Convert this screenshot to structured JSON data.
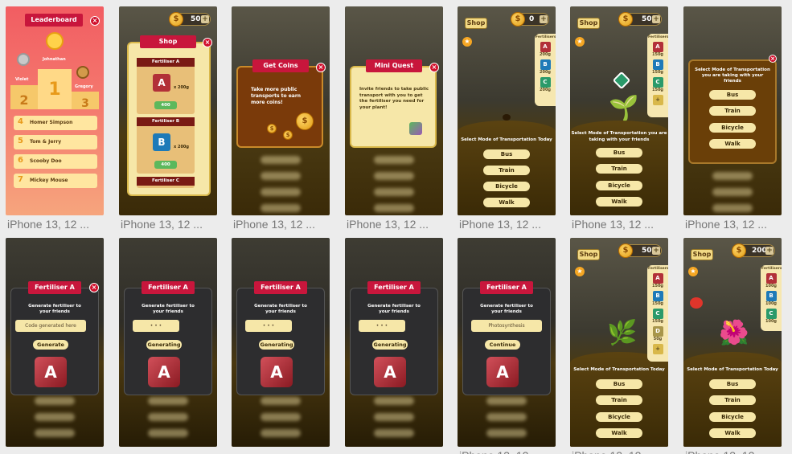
{
  "caption": "iPhone 13, 12 ...",
  "row1": {
    "leaderboard": {
      "title": "Leaderboard",
      "podium": [
        {
          "name": "Violet",
          "rank": "2"
        },
        {
          "name": "Johnathan",
          "rank": "1"
        },
        {
          "name": "Gregory",
          "rank": "3"
        }
      ],
      "list": [
        {
          "rank": "4",
          "name": "Homer Simpson"
        },
        {
          "rank": "5",
          "name": "Tom & Jerry"
        },
        {
          "rank": "6",
          "name": "Scooby Doo"
        },
        {
          "rank": "7",
          "name": "Mickey Mouse"
        }
      ]
    },
    "shop": {
      "coins": "50",
      "title": "Shop",
      "items": [
        {
          "name": "Fertiliser A",
          "letter": "A",
          "qty": "x 200g",
          "price": "400"
        },
        {
          "name": "Fertiliser B",
          "letter": "B",
          "qty": "x 200g",
          "price": "400"
        },
        {
          "name": "Fertiliser C"
        }
      ]
    },
    "get_coins": {
      "title": "Get Coins",
      "text": "Take more public transports to earn more coins!"
    },
    "mini_quest": {
      "title": "Mini Quest",
      "text": "Invite friends to take public transport with you to get the fertiliser you need for your plant!"
    },
    "game1": {
      "shop": "Shop",
      "coins": "0",
      "fert_title": "Fertilisers:",
      "ferts": [
        {
          "letter": "A",
          "w": "200g"
        },
        {
          "letter": "B",
          "w": "200g"
        },
        {
          "letter": "C",
          "w": "200g"
        }
      ],
      "mode_title": "Select Mode of Transportation Today",
      "modes": [
        "Bus",
        "Train",
        "Bicycle",
        "Walk"
      ]
    },
    "game2": {
      "shop": "Shop",
      "coins": "50",
      "fert_title": "Fertilisers:",
      "ferts": [
        {
          "letter": "A",
          "w": "150g"
        },
        {
          "letter": "B",
          "w": "150g"
        },
        {
          "letter": "C",
          "w": "150g"
        }
      ],
      "mode_title": "Select Mode of Transportation you are taking with your friends",
      "modes": [
        "Bus",
        "Train",
        "Bicycle",
        "Walk"
      ]
    },
    "mode_modal": {
      "title": "Select Mode of Transportation you are taking with your friends",
      "modes": [
        "Bus",
        "Train",
        "Bicycle",
        "Walk"
      ]
    }
  },
  "row2": {
    "fertiliser": [
      {
        "title": "Fertiliser A",
        "sub": "Generate fertiliser to your friends",
        "field": "Code generated here",
        "btn": "Generate"
      },
      {
        "title": "Fertiliser A",
        "sub": "Generate fertiliser to your friends",
        "field": "• • •",
        "btn": "Generating"
      },
      {
        "title": "Fertiliser A",
        "sub": "Generate fertiliser to your friends",
        "field": "• • •",
        "btn": "Generating"
      },
      {
        "title": "Fertiliser A",
        "sub": "Generate fertiliser to your friends",
        "field": "• • •",
        "btn": "Generating"
      },
      {
        "title": "Fertiliser A",
        "sub": "Generate fertiliser to your friends",
        "field": "Photosynthesis",
        "btn": "Continue"
      }
    ],
    "game3": {
      "shop": "Shop",
      "coins": "50",
      "fert_title": "Fertilisers:",
      "ferts": [
        {
          "letter": "A",
          "w": "150g"
        },
        {
          "letter": "B",
          "w": "150g"
        },
        {
          "letter": "C",
          "w": "150g"
        },
        {
          "letter": "D",
          "w": "50g"
        }
      ],
      "mode_title": "Select Mode of Transportation Today",
      "modes": [
        "Bus",
        "Train",
        "Bicycle",
        "Walk"
      ]
    },
    "game4": {
      "shop": "Shop",
      "coins": "200",
      "fert_title": "Fertilisers:",
      "ferts": [
        {
          "letter": "A",
          "w": "100g"
        },
        {
          "letter": "B",
          "w": "100g"
        },
        {
          "letter": "C",
          "w": "100g"
        }
      ],
      "mode_title": "Select Mode of Transportation Today",
      "modes": [
        "Bus",
        "Train",
        "Bicycle",
        "Walk"
      ]
    }
  },
  "colors": {
    "ribbon": "#c8163c",
    "cream": "#f6e7a8",
    "gold": "#f2d985",
    "soil": "#3a2a06",
    "pink": "#f27a7a"
  }
}
